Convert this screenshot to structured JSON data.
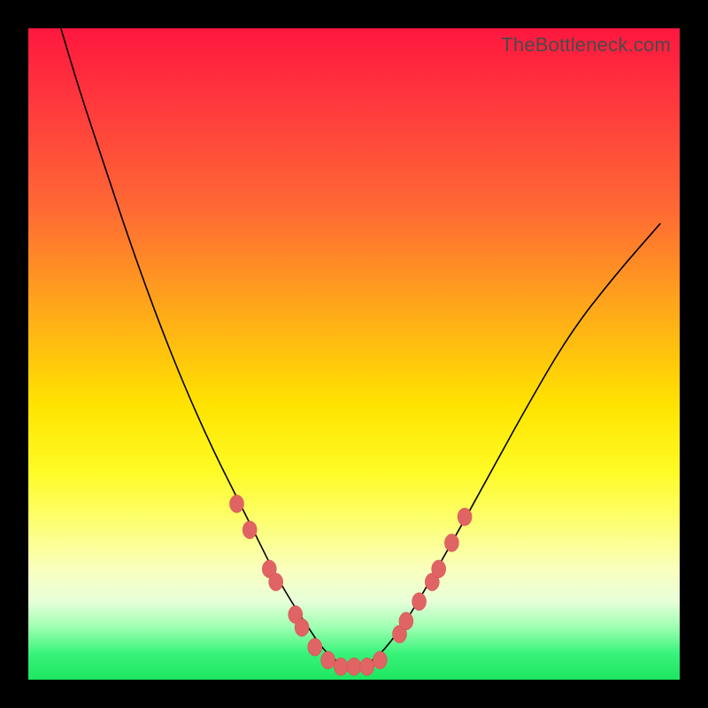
{
  "watermark": "TheBottleneck.com",
  "colors": {
    "frame": "#000000",
    "curve": "#000000",
    "marker_fill": "#e06464",
    "marker_stroke": "#d84a4a",
    "gradient_stops": [
      {
        "offset": 0,
        "color": "#ff173f"
      },
      {
        "offset": 12,
        "color": "#ff3a3d"
      },
      {
        "offset": 28,
        "color": "#ff6a34"
      },
      {
        "offset": 45,
        "color": "#ffb016"
      },
      {
        "offset": 58,
        "color": "#ffe400"
      },
      {
        "offset": 68,
        "color": "#fffb25"
      },
      {
        "offset": 76,
        "color": "#fdff73"
      },
      {
        "offset": 83,
        "color": "#faffbe"
      },
      {
        "offset": 88,
        "color": "#e7ffd9"
      },
      {
        "offset": 92,
        "color": "#9dffb1"
      },
      {
        "offset": 96,
        "color": "#38f37a"
      },
      {
        "offset": 100,
        "color": "#1de65f"
      }
    ]
  },
  "chart_data": {
    "type": "line",
    "title": "",
    "xlabel": "",
    "ylabel": "",
    "xlim": [
      0,
      100
    ],
    "ylim": [
      0,
      100
    ],
    "series": [
      {
        "name": "bottleneck-curve",
        "x": [
          5,
          8,
          12,
          16,
          20,
          24,
          28,
          32,
          35,
          38,
          41,
          43,
          45,
          47,
          49,
          51,
          53,
          55,
          58,
          61,
          65,
          70,
          76,
          83,
          90,
          97
        ],
        "y": [
          100,
          90,
          78,
          66,
          55,
          45,
          36,
          28,
          22,
          16,
          11,
          8,
          5,
          3,
          2,
          2,
          3,
          5,
          9,
          14,
          21,
          30,
          41,
          53,
          62,
          70
        ]
      }
    ],
    "markers": {
      "name": "highlight-points",
      "points": [
        {
          "x": 32,
          "y": 27
        },
        {
          "x": 34,
          "y": 23
        },
        {
          "x": 37,
          "y": 17
        },
        {
          "x": 38,
          "y": 15
        },
        {
          "x": 41,
          "y": 10
        },
        {
          "x": 42,
          "y": 8
        },
        {
          "x": 44,
          "y": 5
        },
        {
          "x": 46,
          "y": 3
        },
        {
          "x": 48,
          "y": 2
        },
        {
          "x": 50,
          "y": 2
        },
        {
          "x": 52,
          "y": 2
        },
        {
          "x": 54,
          "y": 3
        },
        {
          "x": 57,
          "y": 7
        },
        {
          "x": 58,
          "y": 9
        },
        {
          "x": 60,
          "y": 12
        },
        {
          "x": 62,
          "y": 15
        },
        {
          "x": 63,
          "y": 17
        },
        {
          "x": 65,
          "y": 21
        },
        {
          "x": 67,
          "y": 25
        }
      ]
    }
  }
}
